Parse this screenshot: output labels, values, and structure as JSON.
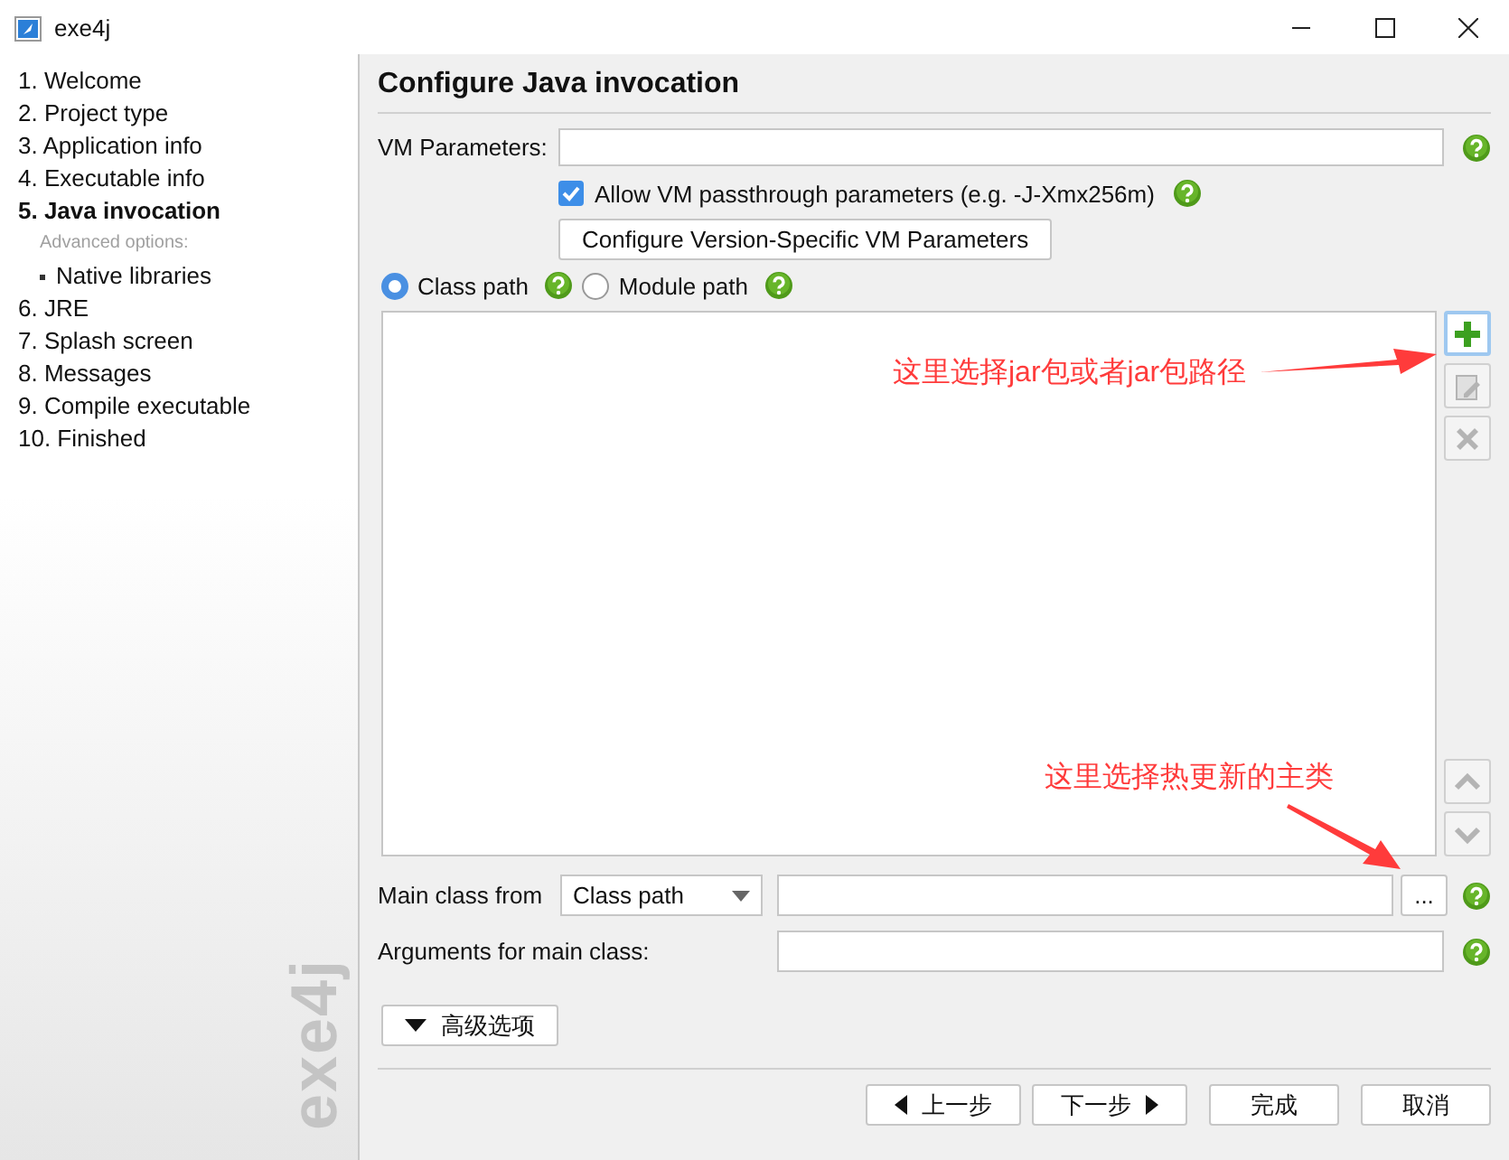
{
  "window": {
    "title": "exe4j"
  },
  "sidebar": {
    "steps": [
      {
        "label": "1. Welcome",
        "kind": "step",
        "selected": false
      },
      {
        "label": "2. Project type",
        "kind": "step",
        "selected": false
      },
      {
        "label": "3. Application info",
        "kind": "step",
        "selected": false
      },
      {
        "label": "4. Executable info",
        "kind": "step",
        "selected": false
      },
      {
        "label": "5. Java invocation",
        "kind": "step",
        "selected": true
      },
      {
        "label": "Advanced options:",
        "kind": "heading",
        "selected": false
      },
      {
        "label": "Native libraries",
        "kind": "sub",
        "selected": false
      },
      {
        "label": "6. JRE",
        "kind": "step",
        "selected": false
      },
      {
        "label": "7. Splash screen",
        "kind": "step",
        "selected": false
      },
      {
        "label": "8. Messages",
        "kind": "step",
        "selected": false
      },
      {
        "label": "9. Compile executable",
        "kind": "step",
        "selected": false
      },
      {
        "label": "10. Finished",
        "kind": "step",
        "selected": false
      }
    ],
    "logo": "exe4j"
  },
  "page": {
    "title": "Configure Java invocation",
    "vm_parameters": {
      "label": "VM Parameters:"
    },
    "passthrough": {
      "label": "Allow VM passthrough parameters (e.g. -J-Xmx256m)",
      "checked": true
    },
    "version_button": "Configure Version-Specific VM Parameters",
    "path_modes": [
      {
        "label": "Class path",
        "selected": true
      },
      {
        "label": "Module path",
        "selected": false
      }
    ],
    "list_tools": [
      {
        "kind": "add",
        "disabled": false
      },
      {
        "kind": "edit",
        "disabled": true
      },
      {
        "kind": "remove",
        "disabled": true
      }
    ],
    "move_tools": [
      {
        "kind": "up",
        "disabled": true
      },
      {
        "kind": "down",
        "disabled": true
      }
    ],
    "main_class": {
      "label": "Main class from",
      "source": "Class path",
      "browse": "..."
    },
    "arguments": {
      "label": "Arguments for main class:"
    },
    "advanced_button": "高级选项"
  },
  "footer": {
    "buttons": [
      {
        "label": "上一步",
        "kind": "back"
      },
      {
        "label": "下一步",
        "kind": "next"
      },
      {
        "label": "完成",
        "kind": "plain"
      },
      {
        "label": "取消",
        "kind": "plain"
      }
    ]
  },
  "annotations": [
    {
      "text": "这里选择jar包或者jar包路径",
      "kind": "right"
    },
    {
      "text": "这里选择热更新的主类",
      "kind": "down"
    }
  ]
}
